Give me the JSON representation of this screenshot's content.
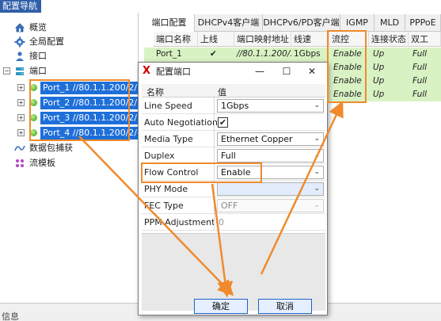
{
  "nav": {
    "title": "配置导航",
    "items": [
      {
        "label": "概览",
        "icon": "home-icon"
      },
      {
        "label": "全局配置",
        "icon": "gear-icon"
      },
      {
        "label": "接口",
        "icon": "user-icon"
      },
      {
        "label": "端口",
        "icon": "server-icon"
      },
      {
        "label": "数据包捕获",
        "icon": "wave-icon"
      },
      {
        "label": "流模板",
        "icon": "template-icon"
      }
    ],
    "ports": [
      "Port_1 //80.1.1.200/2/1",
      "Port_2 //80.1.1.200/2/2",
      "Port_3 //80.1.1.200/2/3",
      "Port_4 //80.1.1.200/2/4"
    ]
  },
  "tabs": [
    "端口配置",
    "DHCPv4客户端",
    "DHCPv6/PD客户端",
    "IGMP",
    "MLD",
    "PPPoE"
  ],
  "grid": {
    "headers": [
      "端口名称",
      "上线",
      "端口映射地址",
      "线速",
      "流控",
      "连接状态",
      "双工"
    ],
    "rows": [
      {
        "name": "Port_1",
        "online": "✔",
        "addr": "//80.1.1.200/...",
        "speed": "1Gbps",
        "flow": "Enable",
        "link": "Up",
        "duplex": "Full"
      },
      {
        "flow": "Enable",
        "link": "Up",
        "duplex": "Full"
      },
      {
        "flow": "Enable",
        "link": "Up",
        "duplex": "Full"
      },
      {
        "flow": "Enable",
        "link": "Up",
        "duplex": "Full"
      }
    ]
  },
  "dialog": {
    "title": "配置端口",
    "col_name": "名称",
    "col_value": "值",
    "props": [
      {
        "name": "Line Speed",
        "value": "1Gbps"
      },
      {
        "name": "Auto Negotiation",
        "value": "✔"
      },
      {
        "name": "Media Type",
        "value": "Ethernet Copper"
      },
      {
        "name": "Duplex",
        "value": "Full"
      },
      {
        "name": "Flow Control",
        "value": "Enable"
      },
      {
        "name": "PHY Mode",
        "value": ""
      },
      {
        "name": "FEC Type",
        "value": "OFF"
      },
      {
        "name": "PPM Adjustment",
        "value": "0"
      }
    ],
    "ok_label": "确定",
    "cancel_label": "取消"
  },
  "status_bar": {
    "label": "信息"
  },
  "colors": {
    "accent": "#1e6fd9",
    "annotation": "#f08a2c",
    "nav_title_bg": "#2f5fa8",
    "selected_row": "#d9f2c4"
  }
}
